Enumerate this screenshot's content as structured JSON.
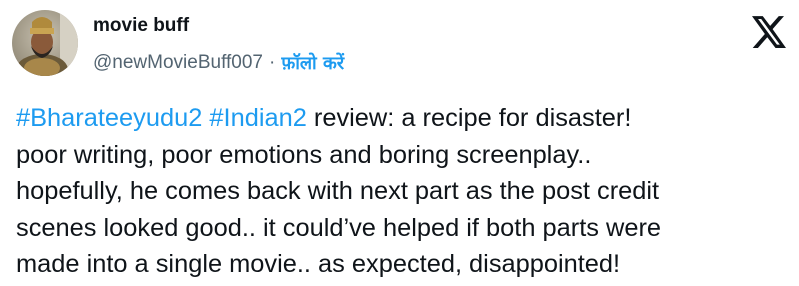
{
  "user": {
    "display_name": "movie buff",
    "handle": "@newMovieBuff007",
    "separator": "·",
    "follow_label": "फ़ॉलो करें"
  },
  "icons": {
    "logo": "x-logo-icon",
    "avatar": "user-avatar-image"
  },
  "tweet": {
    "hashtags": [
      "#Bharateeyudu2",
      "#Indian2"
    ],
    "line1_text": " review: a recipe for disaster!",
    "lines": [
      "poor writing, poor emotions and boring screenplay..",
      "hopefully, he comes back with next part as the post credit",
      "scenes looked good.. it could’ve helped if both parts were",
      "made into a single movie.. as expected, disappointed!"
    ]
  },
  "colors": {
    "accent": "#1d9bf0",
    "text": "#0f1419",
    "secondary": "#536471"
  }
}
